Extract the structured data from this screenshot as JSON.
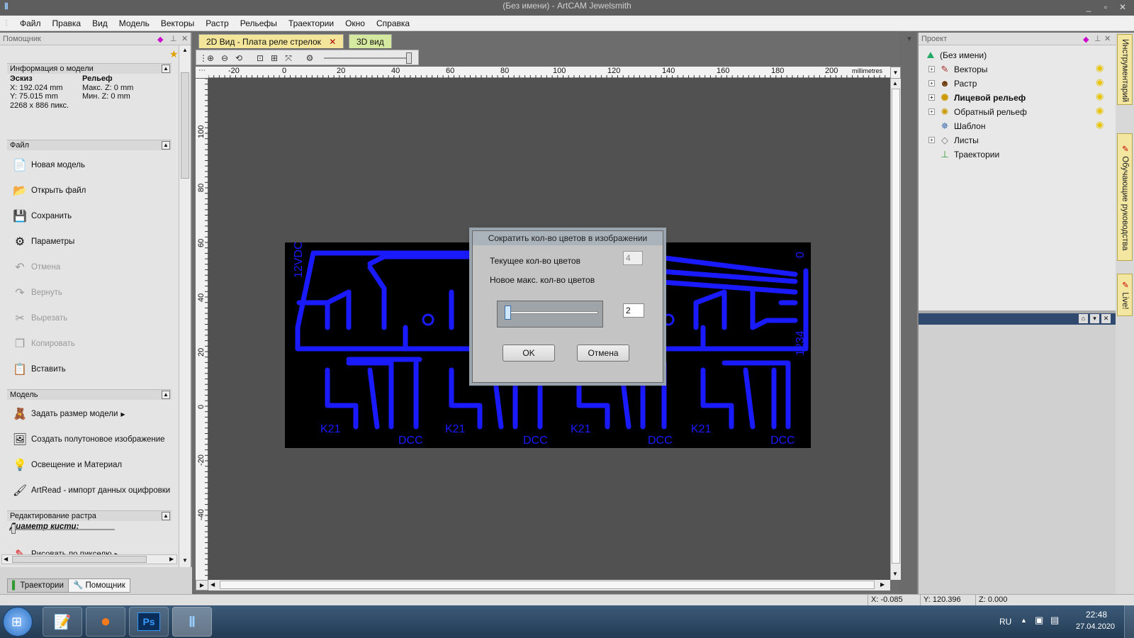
{
  "window": {
    "title": "(Без имени) - ArtCAM Jewelsmith",
    "icon": "artcam-icon",
    "min": "_",
    "max": "▫",
    "close": "✕"
  },
  "menu": [
    "Файл",
    "Правка",
    "Вид",
    "Модель",
    "Векторы",
    "Растр",
    "Рельефы",
    "Траектории",
    "Окно",
    "Справка"
  ],
  "left_panel": {
    "title": "Помощник",
    "info": {
      "header": "Информация о модели",
      "col1_title": "Эскиз",
      "x": "X: 192.024 mm",
      "y": "Y: 75.015 mm",
      "px": "2268 x 886 пикс.",
      "col2_title": "Рельеф",
      "maxz": "Макс. Z: 0 mm",
      "minz": "Мин. Z: 0 mm"
    },
    "file_header": "Файл",
    "file_items": [
      "Новая модель",
      "Открыть файл",
      "Сохранить",
      "Параметры",
      "Отмена",
      "Вернуть",
      "Вырезать",
      "Копировать",
      "Вставить"
    ],
    "model_header": "Модель",
    "model_items": [
      "Задать размер модели",
      "Создать полутоновое изображение",
      "Освещение и Материал",
      "ArtRead - импорт данных оцифровки"
    ],
    "raster_header": "Редактирование растра",
    "brush_label": "Диаметр кисти:",
    "draw_item": "Рисовать по пикселю",
    "bottom_tabs": [
      "Траектории",
      "Помощник"
    ]
  },
  "doc_tabs": [
    "2D Вид - Плата реле стрелок",
    "3D вид"
  ],
  "ruler": {
    "top_labels": [
      "-20",
      "0",
      "20",
      "40",
      "60",
      "80",
      "100",
      "120",
      "140",
      "160",
      "180",
      "200"
    ],
    "units": "millimetres",
    "left_labels": [
      "100",
      "80",
      "60",
      "40",
      "20",
      "0",
      "-20",
      "-40"
    ]
  },
  "pcb": {
    "labels": [
      "12VDC",
      "0",
      "1234",
      "K21",
      "DCC",
      "K21",
      "DCC",
      "K21",
      "DCC",
      "K21",
      "DCC"
    ],
    "trace_color": "#1a1aff",
    "board_color": "#000000"
  },
  "palette_colors": [
    "#000000",
    "#1a1aff"
  ],
  "dialog": {
    "title": "Сократить кол-во цветов в изображении",
    "current_label": "Текущее кол-во цветов",
    "current_value": "4",
    "new_label": "Новое макс. кол-во цветов",
    "new_value": "2",
    "slider_fraction": 0.0,
    "ok": "OK",
    "cancel": "Отмена"
  },
  "right_panel": {
    "title": "Проект",
    "tree": [
      "(Без имени)",
      "Векторы",
      "Растр",
      "Лицевой рельеф",
      "Обратный рельеф",
      "Шаблон",
      "Листы",
      "Траектории"
    ]
  },
  "side_tabs": [
    "Инструментарий",
    "Обучающие руководства",
    "Live!"
  ],
  "status": {
    "x": "X: -0.085",
    "y": "Y: 120.396",
    "z": "Z: 0.000"
  },
  "taskbar": {
    "lang": "RU",
    "time": "22:48",
    "date": "27.04.2020",
    "apps": [
      "start-button",
      "notepad-app",
      "firefox-app",
      "photoshop-app",
      "artcam-app"
    ],
    "ps_label": "Ps"
  }
}
